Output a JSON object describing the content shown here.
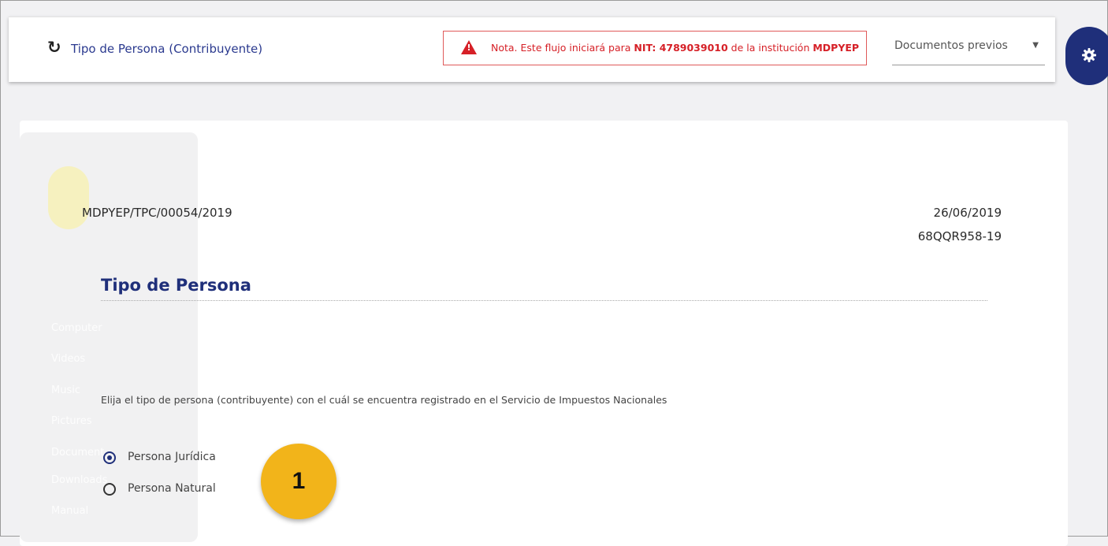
{
  "header": {
    "refresh_icon": "refresh-icon",
    "title": "Tipo de Persona (Contribuyente)",
    "note": {
      "prefix": "Nota. Este flujo iniciará para ",
      "nit": "NIT: 4789039010",
      "middle": " de la institución ",
      "institution": "MDPYEP",
      "icon": "warning-triangle-icon",
      "color": "#d62027"
    },
    "dropdown": {
      "label": "Documentos previos",
      "arrow": "▼"
    },
    "settings_icon": "gear-icon"
  },
  "background_sidebar": {
    "items": [
      "Computer",
      "Videos",
      "Music",
      "Pictures",
      "Document",
      "Downloads",
      "Manual"
    ]
  },
  "document": {
    "code": "MDPYEP/TPC/00054/2019",
    "date": "26/06/2019",
    "reference": "68QQR958-19"
  },
  "section": {
    "title": "Tipo de Persona",
    "instruction": "Elija el tipo de persona (contribuyente) con el cuál se encuentra registrado en el Servicio de Impuestos Nacionales",
    "options": [
      {
        "label": "Persona Jurídica",
        "selected": true
      },
      {
        "label": "Persona Natural",
        "selected": false
      }
    ]
  },
  "step_badge": "1",
  "colors": {
    "primary": "#1f2f7a",
    "alert": "#d62027",
    "badge": "#f2b41a"
  }
}
